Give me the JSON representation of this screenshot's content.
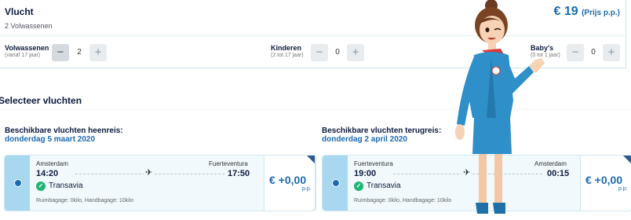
{
  "flight_card": {
    "title": "Vlucht",
    "passengers_summary": "2 Volwassenen",
    "price": "€ 19",
    "price_suffix": "(Prijs p.p.)"
  },
  "passengers": [
    {
      "label": "Volwassenen",
      "sub": "(vanaf 17 jaar)",
      "value": "2",
      "minus": "−",
      "plus": "+"
    },
    {
      "label": "Kinderen",
      "sub": "(2 tot 17 jaar)",
      "value": "0",
      "minus": "−",
      "plus": "+"
    },
    {
      "label": "Baby's",
      "sub": "(0 tot 1 jaar)",
      "value": "0",
      "minus": "−",
      "plus": "+"
    }
  ],
  "section_title": "Selecteer vluchten",
  "outbound": {
    "heading": "Beschikbare vluchten heenreis:",
    "date": "donderdag 5 maart 2020",
    "from_city": "Amsterdam",
    "to_city": "Fuerteventura",
    "dep_time": "14:20",
    "arr_time": "17:50",
    "airline": "Transavia",
    "baggage": "Ruimbagage: 0kilo, Handbagage: 10kilo",
    "price": "€ +0,00",
    "pp": "p.p."
  },
  "return": {
    "heading": "Beschikbare vluchten terugreis:",
    "date": "donderdag 2 april 2020",
    "from_city": "Fuerteventura",
    "to_city": "Amsterdam",
    "dep_time": "19:00",
    "arr_time": "00:15",
    "airline": "Transavia",
    "baggage": "Ruimbagage: 0kilo, Handbagage: 10kilo",
    "price": "€ +0,00",
    "pp": "p.p."
  },
  "icons": {
    "plane": "airplane-icon",
    "airline": "transavia-logo-icon",
    "stewardess": "stewardess-illustration"
  },
  "colors": {
    "accent": "#1c6bb0",
    "rail": "#a7d8ef",
    "uniform": "#2e8fc9",
    "scarf": "#d93b3b"
  }
}
